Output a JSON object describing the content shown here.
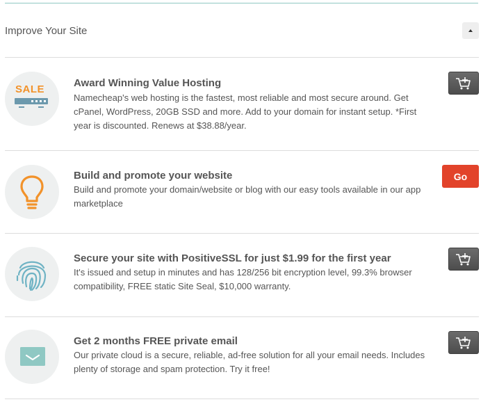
{
  "section": {
    "title": "Improve Your Site"
  },
  "items": [
    {
      "title": "Award Winning Value Hosting",
      "description": "Namecheap's web hosting is the fastest, most reliable and most secure around. Get cPanel, WordPress, 20GB SSD and more. Add to your domain for instant setup. *First year is discounted. Renews at $38.88/year.",
      "icon": "sale-server-icon",
      "icon_text": "SALE",
      "action": "add-to-cart"
    },
    {
      "title": "Build and promote your website",
      "description": "Build and promote your domain/website or blog with our easy tools available in our app marketplace",
      "icon": "lightbulb-icon",
      "action": "go",
      "action_label": "Go"
    },
    {
      "title": "Secure your site with PositiveSSL for just $1.99 for the first year",
      "description": "It's issued and setup in minutes and has 128/256 bit encryption level, 99.3% browser compatibility, FREE static Site Seal, $10,000 warranty.",
      "icon": "fingerprint-icon",
      "action": "add-to-cart"
    },
    {
      "title": "Get 2 months FREE private email",
      "description": "Our private cloud is a secure, reliable, ad-free solution for all your email needs. Includes plenty of storage and spam protection. Try it free!",
      "icon": "envelope-icon",
      "action": "add-to-cart"
    }
  ],
  "colors": {
    "accent_teal": "#8fc8c3",
    "go_red": "#e2432a",
    "cart_gray": "#5a5a5a",
    "sale_orange": "#f2922a",
    "bulb_orange": "#f2922a",
    "fingerprint_blue": "#6fb3c4",
    "envelope_teal": "#8fc8c3"
  }
}
